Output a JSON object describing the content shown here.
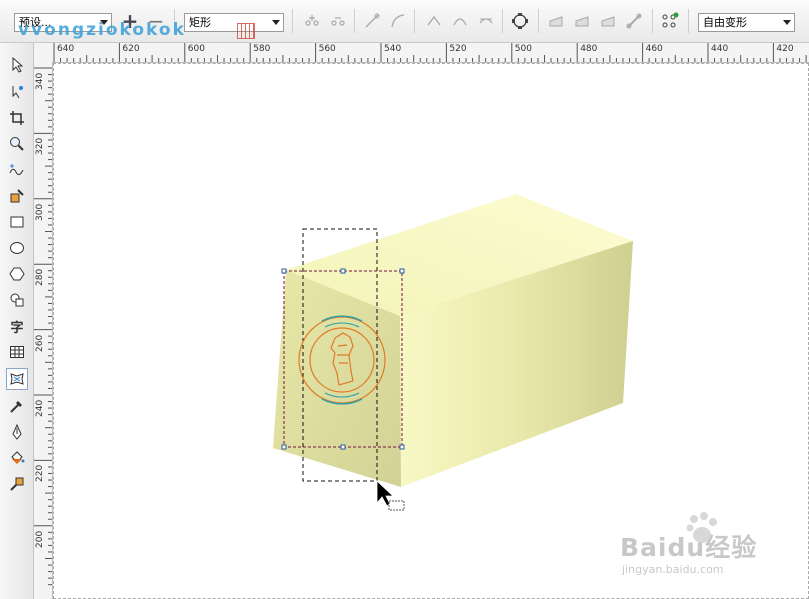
{
  "propbar": {
    "preset_value": "预设...",
    "add_label": "+",
    "remove_label": "−",
    "shape_value": "矩形",
    "mode_value": "自由变形"
  },
  "watermark": {
    "text": "vvongziokokok"
  },
  "ruler": {
    "h_labels": [
      "640",
      "620",
      "600",
      "580",
      "560",
      "540",
      "520",
      "500",
      "480",
      "460",
      "440",
      "420"
    ],
    "v_labels": [
      "340",
      "320",
      "300",
      "280",
      "260",
      "240",
      "220",
      "200"
    ]
  },
  "toolbox": {
    "icons": [
      "pick-icon",
      "shape-icon",
      "crop-icon",
      "zoom-icon",
      "freehand-icon",
      "smart-fill-icon",
      "rectangle-icon",
      "ellipse-icon",
      "polygon-icon",
      "basic-shapes-icon",
      "text-tool-icon",
      "table-icon",
      "envelope-icon",
      "eyedropper-icon",
      "outline-pen-icon",
      "fill-icon",
      "interactive-fill-icon"
    ],
    "text_tool_label": "字"
  },
  "footer_watermark": {
    "brand": "Baidu经验",
    "url": "jingyan.baidu.com"
  },
  "colors": {
    "box_light": "#fbfbc6",
    "box_mid": "#e7e7a6",
    "box_dark": "#c9c98a",
    "logo_orange": "#e07a2a",
    "logo_teal": "#2aa0a8",
    "selection": "#7b0f3c"
  }
}
